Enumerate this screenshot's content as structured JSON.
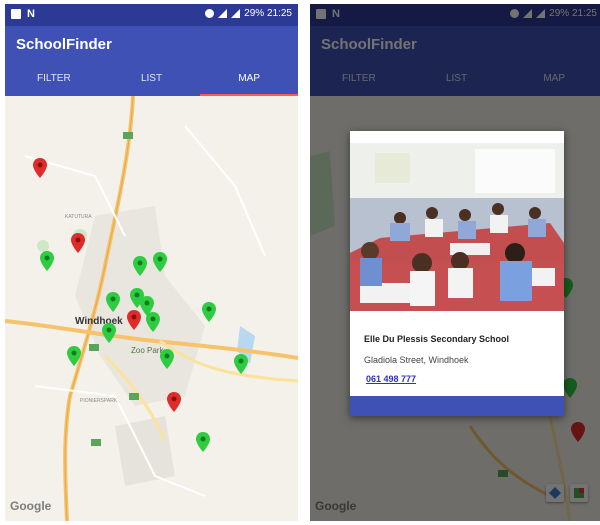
{
  "status_bar": {
    "time": "29% 21:25"
  },
  "app": {
    "title": "SchoolFinder"
  },
  "tabs": [
    {
      "label": "FILTER"
    },
    {
      "label": "LIST"
    },
    {
      "label": "MAP"
    }
  ],
  "map": {
    "city_label": "Windhoek",
    "poi_label": "Zoo Park",
    "district_labels": [
      "KATUTURA",
      "PIONIERSPARK"
    ],
    "attribution": "Google"
  },
  "dialog": {
    "school_name": "Elle Du Plessis Secondary School",
    "address": "Gladiola Street, Windhoek",
    "phone": "061 498 777"
  },
  "colors": {
    "primary": "#3f51b5",
    "primary_dark": "#2d3a95",
    "pin_green": "#2ecc40",
    "pin_red": "#e02b2b",
    "link": "#2c2fc9"
  }
}
